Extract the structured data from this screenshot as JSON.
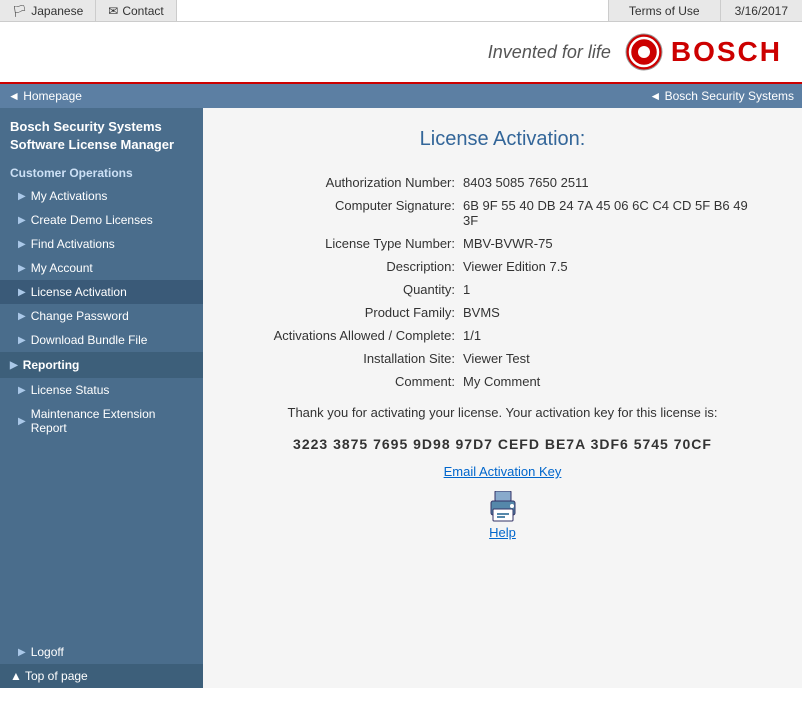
{
  "topbar": {
    "japanese_label": "Japanese",
    "contact_label": "Contact",
    "terms_label": "Terms of Use",
    "date": "3/16/2017",
    "japanese_icon": "🏳",
    "contact_icon": "✉"
  },
  "header": {
    "tagline": "Invented for life",
    "logo_text": "BOSCH"
  },
  "breadcrumb": {
    "left_label": "◄ Homepage",
    "right_label": "◄ Bosch Security Systems"
  },
  "sidebar": {
    "title_line1": "Bosch Security Systems",
    "title_line2": "Software License Manager",
    "customer_ops_label": "Customer Operations",
    "items": [
      {
        "label": "My Activations",
        "id": "my-activations"
      },
      {
        "label": "Create Demo Licenses",
        "id": "create-demo-licenses"
      },
      {
        "label": "Find Activations",
        "id": "find-activations"
      },
      {
        "label": "My Account",
        "id": "my-account"
      },
      {
        "label": "License Activation",
        "id": "license-activation"
      },
      {
        "label": "Change Password",
        "id": "change-password"
      },
      {
        "label": "Download Bundle File",
        "id": "download-bundle-file"
      }
    ],
    "reporting_label": "Reporting",
    "reporting_items": [
      {
        "label": "License Status",
        "id": "license-status"
      },
      {
        "label": "Maintenance Extension Report",
        "id": "maintenance-extension-report"
      }
    ],
    "logoff_label": "Logoff",
    "top_of_page_label": "▲ Top of page"
  },
  "content": {
    "title": "License Activation:",
    "fields": [
      {
        "label": "Authorization Number:",
        "value": "8403 5085 7650 2511"
      },
      {
        "label": "Computer Signature:",
        "value": "6B 9F 55 40 DB 24 7A 45 06 6C C4 CD 5F B6 49 3F"
      },
      {
        "label": "License Type Number:",
        "value": "MBV-BVWR-75"
      },
      {
        "label": "Description:",
        "value": "Viewer Edition 7.5"
      },
      {
        "label": "Quantity:",
        "value": "1"
      },
      {
        "label": "Product Family:",
        "value": "BVMS"
      },
      {
        "label": "Activations Allowed / Complete:",
        "value": "1/1"
      },
      {
        "label": "Installation Site:",
        "value": "Viewer Test"
      },
      {
        "label": "Comment:",
        "value": "My Comment"
      }
    ],
    "thank_you_text": "Thank you for activating your license. Your activation key for this license is:",
    "activation_key": "3223 3875 7695 9D98 97D7 CEFD BE7A 3DF6 5745 70CF",
    "email_link_label": "Email Activation Key",
    "help_label": "Help"
  }
}
